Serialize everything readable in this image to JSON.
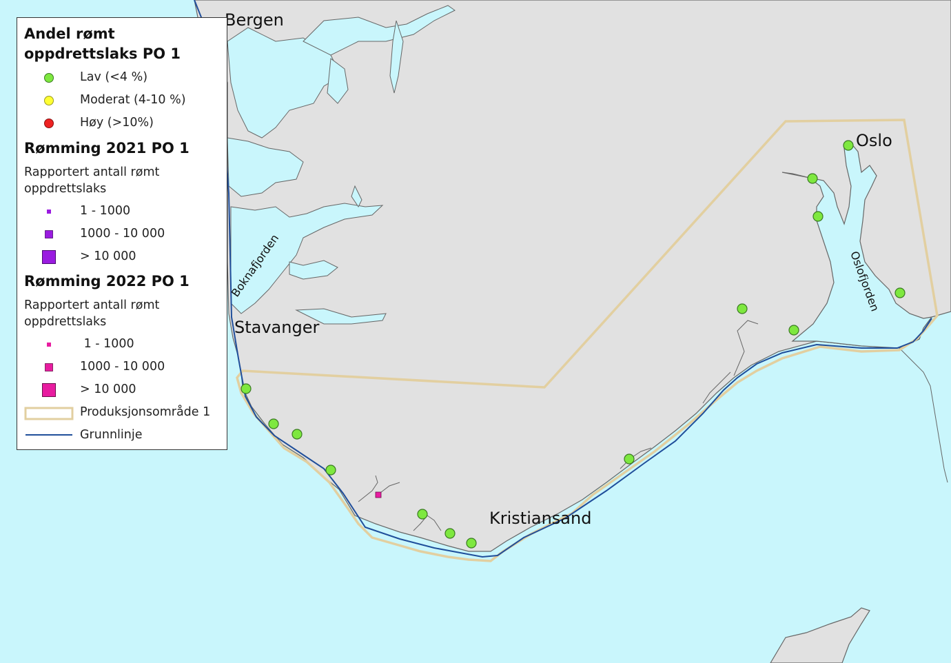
{
  "legend": {
    "section1_title": "Andel rømt oppdrettslaks PO 1",
    "section1_title_line1": "Andel rømt",
    "section1_title_line2": "oppdrettslaks PO 1",
    "low_label": "Lav (<4 %)",
    "moderate_label": "Moderat (4-10 %)",
    "high_label": "Høy (>10%)",
    "section2_title": "Rømming 2021 PO 1",
    "section2_subtitle_line1": "Rapportert antall rømt",
    "section2_subtitle_line2": "oppdrettslaks",
    "s2_small": "1 - 1000",
    "s2_medium": "1000 - 10 000",
    "s2_large": "> 10 000",
    "section3_title": "Rømming 2022 PO 1",
    "section3_subtitle_line1": "Rapportert antall rømt",
    "section3_subtitle_line2": "oppdrettslaks",
    "s3_small": " 1 - 1000",
    "s3_medium": "1000 - 10 000",
    "s3_large": "> 10 000",
    "area_label": "Produksjonsområde 1",
    "baseline_label": "Grunnlinje",
    "colors": {
      "low": "#7ee83f",
      "moderate": "#ffff33",
      "high": "#ee2222",
      "escape_2021": "#9a1be0",
      "escape_2022": "#e81ca0",
      "area": "#e8d3a6",
      "baseline": "#1f4e9a"
    }
  },
  "map": {
    "places": {
      "bergen": "Bergen",
      "stavanger": "Stavanger",
      "kristiansand": "Kristiansand",
      "oslo": "Oslo",
      "boknafjorden": "Boknafjorden",
      "oslofjorden": "Oslofjorden"
    },
    "colors": {
      "sea": "#c9f6fc",
      "land": "#e1e1e1",
      "coastline": "#666666"
    }
  }
}
